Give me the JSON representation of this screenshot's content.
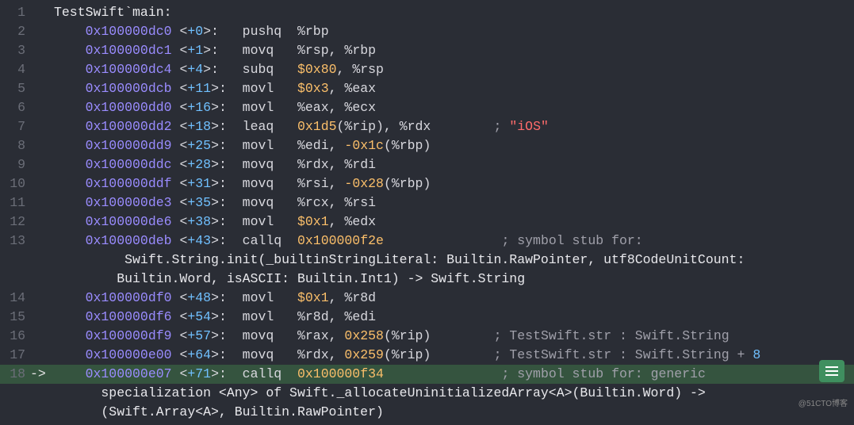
{
  "header_line": "TestSwift`main:",
  "watermark": "@51CTO博客",
  "rows": [
    {
      "ln": 1,
      "arrow": "",
      "indent": 0,
      "addr": null,
      "off": null,
      "mn": null,
      "plain": "TestSwift`main:",
      "cmt": null,
      "str": null
    },
    {
      "ln": 2,
      "arrow": "",
      "indent": 2,
      "addr": "0x100000dc0",
      "off": "+0",
      "mn": "pushq",
      "ops": [
        [
          "reg",
          "%rbp"
        ]
      ],
      "cmt": null
    },
    {
      "ln": 3,
      "arrow": "",
      "indent": 2,
      "addr": "0x100000dc1",
      "off": "+1",
      "mn": "movq",
      "ops": [
        [
          "reg",
          "%rsp"
        ],
        [
          "reg",
          ", %rbp"
        ]
      ],
      "cmt": null
    },
    {
      "ln": 4,
      "arrow": "",
      "indent": 2,
      "addr": "0x100000dc4",
      "off": "+4",
      "mn": "subq",
      "ops": [
        [
          "hex",
          "$0x80"
        ],
        [
          "reg",
          ", %rsp"
        ]
      ],
      "cmt": null
    },
    {
      "ln": 5,
      "arrow": "",
      "indent": 2,
      "addr": "0x100000dcb",
      "off": "+11",
      "mn": "movl",
      "ops": [
        [
          "hex",
          "$0x3"
        ],
        [
          "reg",
          ", %eax"
        ]
      ],
      "cmt": null
    },
    {
      "ln": 6,
      "arrow": "",
      "indent": 2,
      "addr": "0x100000dd0",
      "off": "+16",
      "mn": "movl",
      "ops": [
        [
          "reg",
          "%eax"
        ],
        [
          "reg",
          ", %ecx"
        ]
      ],
      "cmt": null
    },
    {
      "ln": 7,
      "arrow": "",
      "indent": 2,
      "addr": "0x100000dd2",
      "off": "+18",
      "mn": "leaq",
      "ops": [
        [
          "hex",
          "0x1d5"
        ],
        [
          "reg",
          "(%rip), %rdx"
        ]
      ],
      "cmt_pre": "        ; ",
      "str": "\"iOS\""
    },
    {
      "ln": 8,
      "arrow": "",
      "indent": 2,
      "addr": "0x100000dd9",
      "off": "+25",
      "mn": "movl",
      "ops": [
        [
          "reg",
          "%edi, "
        ],
        [
          "hex",
          "-0x1c"
        ],
        [
          "reg",
          "(%rbp)"
        ]
      ],
      "cmt": null
    },
    {
      "ln": 9,
      "arrow": "",
      "indent": 2,
      "addr": "0x100000ddc",
      "off": "+28",
      "mn": "movq",
      "ops": [
        [
          "reg",
          "%rdx"
        ],
        [
          "reg",
          ", %rdi"
        ]
      ],
      "cmt": null
    },
    {
      "ln": 10,
      "arrow": "",
      "indent": 2,
      "addr": "0x100000ddf",
      "off": "+31",
      "mn": "movq",
      "ops": [
        [
          "reg",
          "%rsi, "
        ],
        [
          "hex",
          "-0x28"
        ],
        [
          "reg",
          "(%rbp)"
        ]
      ],
      "cmt": null
    },
    {
      "ln": 11,
      "arrow": "",
      "indent": 2,
      "addr": "0x100000de3",
      "off": "+35",
      "mn": "movq",
      "ops": [
        [
          "reg",
          "%rcx"
        ],
        [
          "reg",
          ", %rsi"
        ]
      ],
      "cmt": null
    },
    {
      "ln": 12,
      "arrow": "",
      "indent": 2,
      "addr": "0x100000de6",
      "off": "+38",
      "mn": "movl",
      "ops": [
        [
          "hex",
          "$0x1"
        ],
        [
          "reg",
          ", %edx"
        ]
      ],
      "cmt": null
    },
    {
      "ln": 13,
      "arrow": "",
      "indent": 2,
      "addr": "0x100000deb",
      "off": "+43",
      "mn": "callq",
      "ops": [
        [
          "hex",
          "0x100000f2e"
        ]
      ],
      "cmt": "               ; symbol stub for:"
    },
    {
      "ln": null,
      "arrow": "",
      "indent": 4,
      "plain": " Swift.String.init(_builtinStringLiteral: Builtin.RawPointer, utf8CodeUnitCount:"
    },
    {
      "ln": null,
      "arrow": "",
      "indent": 4,
      "plain": "Builtin.Word, isASCII: Builtin.Int1) -> Swift.String"
    },
    {
      "ln": 14,
      "arrow": "",
      "indent": 2,
      "addr": "0x100000df0",
      "off": "+48",
      "mn": "movl",
      "ops": [
        [
          "hex",
          "$0x1"
        ],
        [
          "reg",
          ", %r8d"
        ]
      ],
      "cmt": null
    },
    {
      "ln": 15,
      "arrow": "",
      "indent": 2,
      "addr": "0x100000df6",
      "off": "+54",
      "mn": "movl",
      "ops": [
        [
          "reg",
          "%r8d"
        ],
        [
          "reg",
          ", %edi"
        ]
      ],
      "cmt": null
    },
    {
      "ln": 16,
      "arrow": "",
      "indent": 2,
      "addr": "0x100000df9",
      "off": "+57",
      "mn": "movq",
      "ops": [
        [
          "reg",
          "%rax, "
        ],
        [
          "hex",
          "0x258"
        ],
        [
          "reg",
          "(%rip)"
        ]
      ],
      "cmt": "        ; TestSwift.str : Swift.String"
    },
    {
      "ln": 17,
      "arrow": "",
      "indent": 2,
      "addr": "0x100000e00",
      "off": "+64",
      "mn": "movq",
      "ops": [
        [
          "reg",
          "%rdx, "
        ],
        [
          "hex",
          "0x259"
        ],
        [
          "reg",
          "(%rip)"
        ]
      ],
      "cmt": "        ; TestSwift.str : Swift.String + ",
      "tailnum": "8"
    },
    {
      "ln": 18,
      "arrow": "->",
      "indent": 2,
      "addr": "0x100000e07",
      "off": "+71",
      "mn": "callq",
      "ops": [
        [
          "hex",
          "0x100000f34"
        ]
      ],
      "cmt": "               ; symbol stub for: generic",
      "current": true
    },
    {
      "ln": null,
      "arrow": "",
      "indent": 2,
      "plain": "  specialization <Any> of Swift._allocateUninitializedArray<A>(Builtin.Word) ->"
    },
    {
      "ln": null,
      "arrow": "",
      "indent": 2,
      "plain": "  (Swift.Array<A>, Builtin.RawPointer)"
    }
  ]
}
